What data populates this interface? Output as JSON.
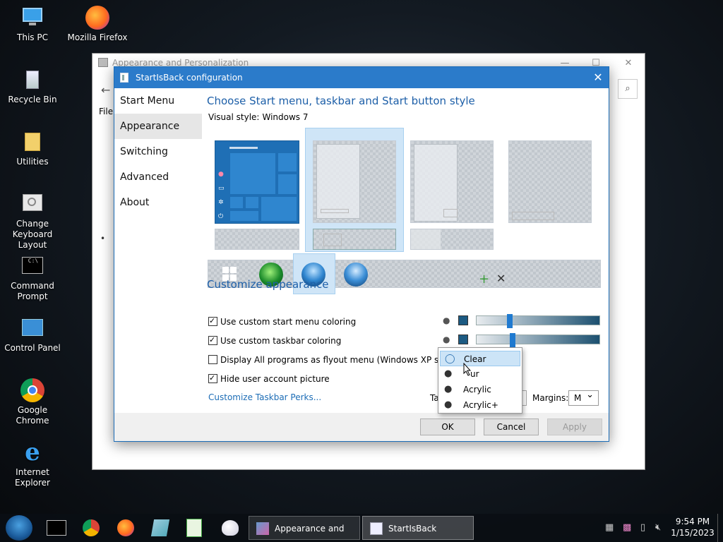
{
  "desktop": {
    "icons": [
      {
        "label": "This PC",
        "icon": "this-pc-icon"
      },
      {
        "label": "Mozilla Firefox",
        "icon": "firefox-icon"
      },
      {
        "label": "Recycle Bin",
        "icon": "recycle-bin-icon"
      },
      {
        "label": "Utilities",
        "icon": "folder-icon"
      },
      {
        "label": "Change Keyboard Layout",
        "icon": "keyboard-layout-icon"
      },
      {
        "label": "Command Prompt",
        "icon": "command-prompt-icon"
      },
      {
        "label": "Control Panel",
        "icon": "control-panel-icon"
      },
      {
        "label": "Google Chrome",
        "icon": "chrome-icon"
      },
      {
        "label": "Internet Explorer",
        "icon": "internet-explorer-icon"
      }
    ]
  },
  "bg_window": {
    "title": "Appearance and Personalization",
    "menu_file": "File",
    "bullet": "•"
  },
  "dialog": {
    "title": "StartIsBack configuration",
    "close": "✕",
    "nav": [
      "Start Menu",
      "Appearance",
      "Switching",
      "Advanced",
      "About"
    ],
    "selected_nav": "Appearance",
    "heading": "Choose Start menu, taskbar and Start button style",
    "visual_style_label": "Visual style:",
    "visual_style_value": "Windows 7",
    "customize_heading": "Customize appearance",
    "add_symbol": "+",
    "remove_symbol": "✕",
    "options": [
      {
        "label": "Use custom start menu coloring",
        "checked": true
      },
      {
        "label": "Use custom taskbar coloring",
        "checked": true
      },
      {
        "label": "Display All programs as flyout menu (Windows XP style)",
        "checked": false
      },
      {
        "label": "Hide user account picture",
        "checked": true
      }
    ],
    "link": "Customize Taskbar Perks...",
    "taskbar_label_partial": "Ta",
    "margins_label": "Margins:",
    "margins_value": "M",
    "swatch_color": "#1c5a82",
    "slider1_value": 0.27,
    "slider2_value": 0.29,
    "buttons": {
      "ok": "OK",
      "cancel": "Cancel",
      "apply": "Apply"
    }
  },
  "popup_menu": {
    "items": [
      {
        "label": "Clear",
        "icon": "drop-outline-icon",
        "highlighted": true
      },
      {
        "label": "ur",
        "icon": "drop-filled-icon",
        "highlighted": false
      },
      {
        "label": "Acrylic",
        "icon": "drop-filled-icon",
        "highlighted": false
      },
      {
        "label": "Acrylic+",
        "icon": "drop-filled-icon",
        "highlighted": false
      }
    ]
  },
  "taskbar": {
    "tasks": [
      {
        "label": "Appearance and Pe...",
        "icon": "appearance-icon"
      },
      {
        "label": "StartIsBack configu...",
        "icon": "startisback-icon"
      }
    ],
    "time": "9:54 PM",
    "date": "1/15/2023"
  }
}
